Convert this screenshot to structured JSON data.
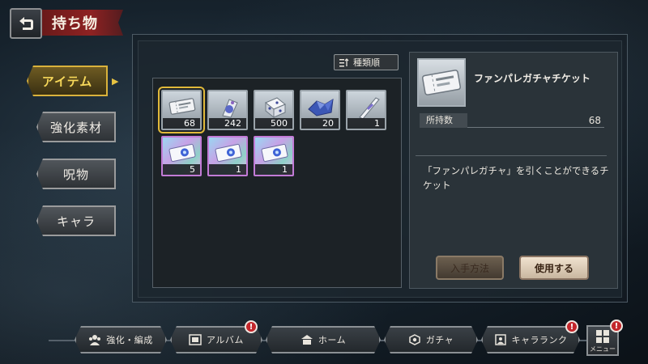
{
  "header": {
    "title": "持ち物",
    "back_icon": "back-arrow-icon"
  },
  "categories": [
    {
      "label": "アイテム",
      "active": true
    },
    {
      "label": "強化素材",
      "active": false
    },
    {
      "label": "呪物",
      "active": false
    },
    {
      "label": "キャラ",
      "active": false
    }
  ],
  "sort": {
    "label": "種類順",
    "icon": "sort-icon"
  },
  "items": [
    {
      "name": "fanpare-gacha-ticket",
      "qty": "68",
      "selected": true,
      "rarity": "normal"
    },
    {
      "name": "blue-potion",
      "qty": "242",
      "selected": false,
      "rarity": "normal"
    },
    {
      "name": "dice-box",
      "qty": "500",
      "selected": false,
      "rarity": "normal"
    },
    {
      "name": "blue-crystal",
      "qty": "20",
      "selected": false,
      "rarity": "normal"
    },
    {
      "name": "blade-item",
      "qty": "1",
      "selected": false,
      "rarity": "normal"
    },
    {
      "name": "rainbow-ticket-a",
      "qty": "5",
      "selected": false,
      "rarity": "rainbow"
    },
    {
      "name": "rainbow-ticket-b",
      "qty": "1",
      "selected": false,
      "rarity": "rainbow"
    },
    {
      "name": "rainbow-ticket-c",
      "qty": "1",
      "selected": false,
      "rarity": "rainbow"
    }
  ],
  "detail": {
    "name": "ファンパレガチャチケット",
    "owned_label": "所持数",
    "owned_value": "68",
    "description": "「ファンパレガチャ」を引くことができるチケット",
    "howto_label": "入手方法",
    "use_label": "使用する"
  },
  "nav": [
    {
      "label": "強化・編成",
      "icon": "party-icon",
      "badge": ""
    },
    {
      "label": "アルバム",
      "icon": "album-icon",
      "badge": "!"
    },
    {
      "label": "ホーム",
      "icon": "home-icon",
      "badge": ""
    },
    {
      "label": "ガチャ",
      "icon": "gacha-icon",
      "badge": ""
    },
    {
      "label": "キャラランク",
      "icon": "rank-icon",
      "badge": "!"
    }
  ],
  "menu": {
    "label": "メニュー",
    "badge": "!",
    "icon": "grid-menu-icon"
  },
  "colors": {
    "accent_gold": "#e1b93a",
    "title_red": "#8e2222",
    "badge_red": "#c3262b"
  }
}
